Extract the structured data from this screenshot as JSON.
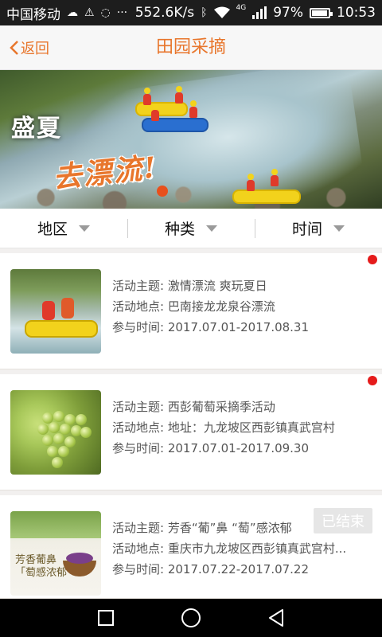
{
  "status_bar": {
    "carrier": "中国移动",
    "speed": "552.6K/s",
    "network_label": "4G",
    "battery": "97%",
    "battery_level": 0.97,
    "time": "10:53"
  },
  "header": {
    "back_label": "返回",
    "title": "田园采摘"
  },
  "banner": {
    "line1": "盛夏",
    "line2": "去漂流!"
  },
  "filters": [
    {
      "label": "地区"
    },
    {
      "label": "种类"
    },
    {
      "label": "时间"
    }
  ],
  "activities": [
    {
      "theme_label": "活动主题:",
      "theme": "激情漂流 爽玩夏日",
      "place_label": "活动地点:",
      "place": "巴南接龙龙泉谷漂流",
      "time_label": "参与时间:",
      "time": "2017.07.01-2017.08.31",
      "is_new": true,
      "thumbnail": "rafting-photo"
    },
    {
      "theme_label": "活动主题:",
      "theme": "西彭葡萄采摘季活动",
      "place_label": "活动地点:",
      "place": "地址：九龙坡区西彭镇真武宫村",
      "time_label": "参与时间:",
      "time": "2017.07.01-2017.09.30",
      "is_new": true,
      "thumbnail": "grapes-photo"
    },
    {
      "theme_label": "活动主题:",
      "theme": "芳香“葡”鼻 “萄”感浓郁",
      "place_label": "活动地点:",
      "place": "重庆市九龙坡区西彭镇真武宫村...",
      "time_label": "参与时间:",
      "time": "2017.07.22-2017.07.22",
      "status_badge": "已结束",
      "thumbnail": "grape-poster",
      "thumb_text_1": "芳香葡鼻",
      "thumb_text_2": "「萄感浓郁"
    }
  ],
  "colors": {
    "accent": "#e8762c",
    "new_dot": "#e51b1b"
  }
}
